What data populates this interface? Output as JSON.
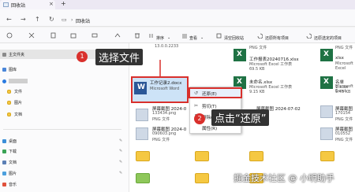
{
  "window": {
    "tab_title": "回收站",
    "close_tab": "×",
    "new_tab": "+"
  },
  "address": {
    "location": "回收站",
    "back": "←",
    "forward": "→",
    "up": "↑",
    "refresh": "↻",
    "monitor": "▭",
    "chevron": "›"
  },
  "toolbar": {
    "sort_label": "排序",
    "view_label": "查看",
    "empty_recycle_label": "清空回收站",
    "restore_selected_label": "还原所有项目",
    "restore_selection_label": "还原选定的项目",
    "dropdown_glyph": "⌄",
    "more_glyph": "···"
  },
  "sidebar": {
    "items": [
      {
        "label": "主文件夹"
      },
      {
        "label": "图库"
      },
      {
        "label": "文件"
      },
      {
        "label": "图片"
      },
      {
        "label": "文档"
      },
      {
        "label": "桌面"
      },
      {
        "label": "下载"
      },
      {
        "label": "文档"
      },
      {
        "label": "图片"
      },
      {
        "label": "音乐"
      }
    ]
  },
  "files": [
    {
      "name": "13.0.0.2233",
      "meta": ""
    },
    {
      "name": "工作报表20240716.xlsx",
      "meta": "Microsoft Excel 工作表",
      "meta2": "69.5 KB"
    },
    {
      "name": "工作记录2.docx",
      "meta": "Microsoft Word"
    },
    {
      "name": "屏幕截图 2024-0",
      "meta": "133434.png",
      "meta2": "PNG 文件"
    },
    {
      "name": "屏幕截图 2024-0",
      "meta": "090603.png",
      "meta2": "PNG 文件"
    },
    {
      "name": "PNG 文件",
      "meta": ""
    },
    {
      "name": "PNG 文件",
      "meta": ""
    },
    {
      "name": "xlsx",
      "meta": ""
    },
    {
      "name": "Microsoft Excel",
      "meta": ""
    },
    {
      "name": "未命名.xlsx",
      "meta": "Microsoft Excel 工作表",
      "meta2": "9.15 KB"
    },
    {
      "name": "名单1.xlsx",
      "meta": "Microsoft Excel",
      "meta2": "9.45 KB"
    },
    {
      "name": "屏幕截图 2024-07-02",
      "meta": ""
    },
    {
      "name": "屏幕截图",
      "meta": "170154",
      "meta2": "PNG 文件"
    },
    {
      "name": "屏幕截图",
      "meta": "010552",
      "meta2": "PNG 文件"
    }
  ],
  "context_menu": {
    "items": [
      "还原(E)",
      "剪切(T)",
      "删除(D)",
      "属性(R)"
    ]
  },
  "annotations": {
    "step1_badge": "1",
    "step1_text": "选择文件",
    "step2_badge": "2",
    "step2_text": "点击“还原”"
  },
  "watermark": "掘金技术社区 @ 小明助手",
  "colors": {
    "accent": "#d9302c",
    "callout_bg": "#333333",
    "excel_green": "#1f7244"
  }
}
